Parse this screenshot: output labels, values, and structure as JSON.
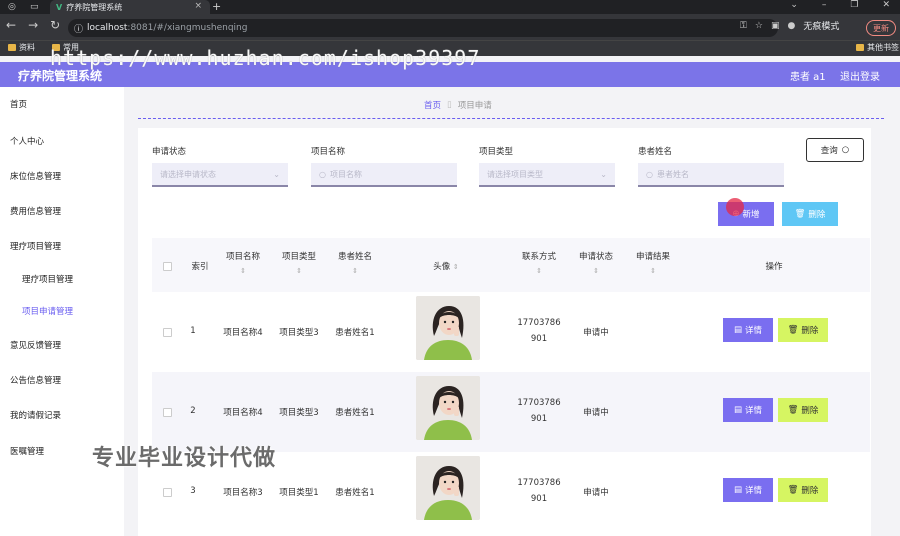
{
  "browser": {
    "tab_title": "疗养院管理系统",
    "url_host": "localhost",
    "url_rest": ":8081/#/xiangmushenqing",
    "incognito_label": "无痕模式",
    "update_label": "更新",
    "bookmarks": [
      "资料",
      "常用",
      "其他书签"
    ]
  },
  "watermarks": {
    "url": "https://www.huzhan.com/ishop39397",
    "cn": "专业毕业设计代做"
  },
  "header": {
    "title": "疗养院管理系统",
    "user": "患者 a1",
    "logout": "退出登录"
  },
  "sidebar": {
    "items": [
      "首页",
      "个人中心",
      "床位信息管理",
      "费用信息管理",
      "理疗项目管理",
      "理疗项目管理",
      "项目申请管理",
      "意见反馈管理",
      "公告信息管理",
      "我的请假记录",
      "医嘱管理"
    ]
  },
  "breadcrumb": {
    "home": "首页",
    "current": "项目申请"
  },
  "search": {
    "status_label": "申请状态",
    "status_placeholder": "请选择申请状态",
    "name_label": "项目名称",
    "name_placeholder": "项目名称",
    "type_label": "项目类型",
    "type_placeholder": "请选择项目类型",
    "patient_label": "患者姓名",
    "patient_placeholder": "患者姓名",
    "query_button": "查询"
  },
  "actions": {
    "add": "新增",
    "delete": "删除"
  },
  "table": {
    "headers": {
      "index": "索引",
      "name": "项目名称",
      "type": "项目类型",
      "patient": "患者姓名",
      "avatar": "头像",
      "phone": "联系方式",
      "status": "申请状态",
      "result": "申请结果",
      "ops": "操作"
    },
    "rows": [
      {
        "index": "1",
        "name": "项目名称4",
        "type": "项目类型3",
        "patient": "患者姓名1",
        "phone1": "17703786",
        "phone2": "901",
        "status": "申请中",
        "result": ""
      },
      {
        "index": "2",
        "name": "项目名称4",
        "type": "项目类型3",
        "patient": "患者姓名1",
        "phone1": "17703786",
        "phone2": "901",
        "status": "申请中",
        "result": ""
      },
      {
        "index": "3",
        "name": "项目名称3",
        "type": "项目类型1",
        "patient": "患者姓名1",
        "phone1": "17703786",
        "phone2": "901",
        "status": "申请中",
        "result": ""
      }
    ],
    "detail_label": "详情",
    "delete_label": "删除"
  },
  "colors": {
    "primary": "#7a6ef0",
    "header": "#7b74e8",
    "danger_btn": "#d6f562",
    "info_btn": "#5fc7f5"
  }
}
